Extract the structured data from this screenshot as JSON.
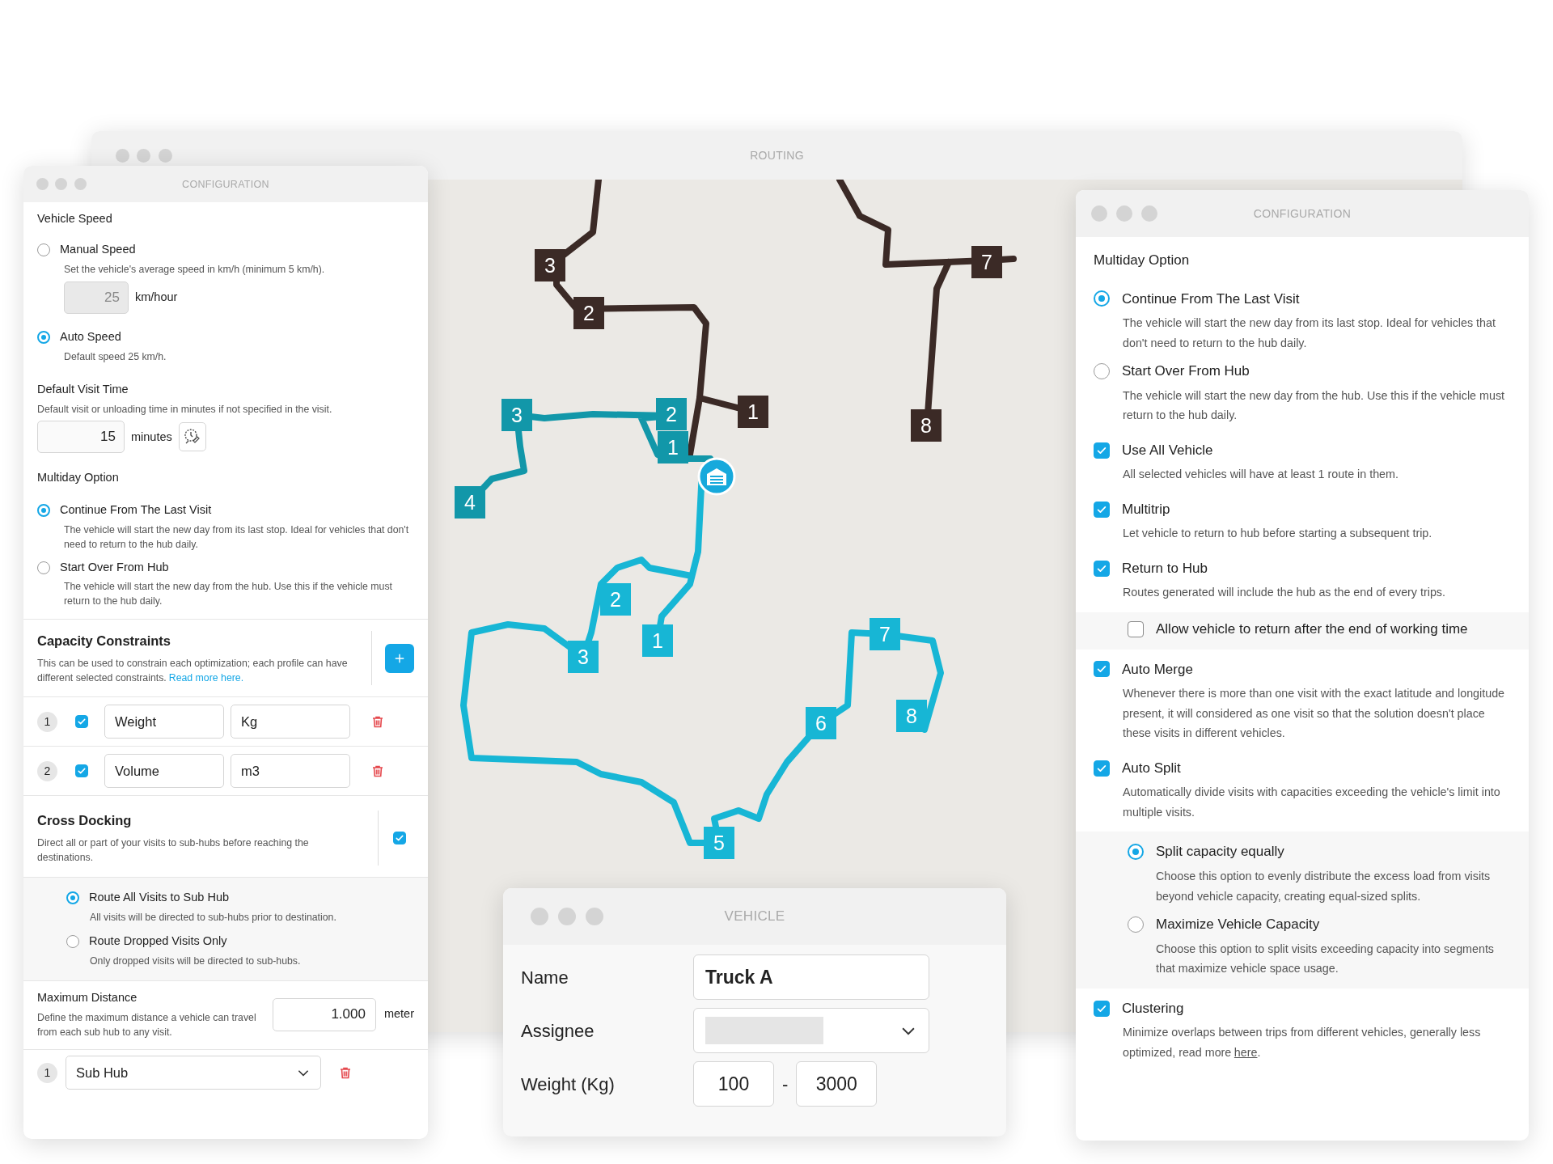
{
  "routing_window": {
    "title": "ROUTING",
    "map": {
      "routes": [
        {
          "color": "#3b2a26",
          "stops": [
            "3",
            "2",
            "1"
          ]
        },
        {
          "color": "#3b2a26",
          "stops": [
            "7",
            "8"
          ]
        },
        {
          "color": "#1297a9",
          "stops": [
            "3",
            "2",
            "1",
            "4"
          ]
        },
        {
          "color": "#17b6d5",
          "stops": [
            "2",
            "3",
            "1",
            "5",
            "6",
            "7",
            "8"
          ]
        }
      ]
    }
  },
  "left_config": {
    "title": "CONFIGURATION",
    "vehicle_speed": {
      "heading": "Vehicle Speed",
      "options": [
        {
          "label": "Manual Speed",
          "description": "Set the vehicle's average speed in km/h (minimum 5 km/h).",
          "selected": false,
          "value": "25",
          "unit": "km/hour"
        },
        {
          "label": "Auto Speed",
          "description": "Default speed 25 km/h.",
          "selected": true
        }
      ]
    },
    "default_visit_time": {
      "heading": "Default Visit Time",
      "description": "Default visit or unloading time in minutes if not specified in the visit.",
      "value": "15",
      "unit": "minutes"
    },
    "multiday_option": {
      "heading": "Multiday Option",
      "options": [
        {
          "label": "Continue From The Last Visit",
          "description": "The vehicle will start the new day from its last stop. Ideal for vehicles that don't need to return to the hub daily.",
          "selected": true
        },
        {
          "label": "Start Over From Hub",
          "description": "The vehicle will start the new day from the hub. Use this if the vehicle must return to the hub daily.",
          "selected": false
        }
      ]
    },
    "capacity_constraints": {
      "heading": "Capacity Constraints",
      "description": "This can be used to constrain each optimization; each profile can have different selected constraints.",
      "link": "Read more here.",
      "rows": [
        {
          "number": "1",
          "checked": true,
          "name": "Weight",
          "unit": "Kg"
        },
        {
          "number": "2",
          "checked": true,
          "name": "Volume",
          "unit": "m3"
        }
      ]
    },
    "cross_docking": {
      "heading": "Cross Docking",
      "description": "Direct all or part of your visits to sub-hubs before reaching the destinations.",
      "checked": true,
      "options": [
        {
          "label": "Route All Visits to Sub Hub",
          "description": "All visits will be directed to sub-hubs prior to destination.",
          "selected": true
        },
        {
          "label": "Route Dropped Visits Only",
          "description": "Only dropped visits will be directed to sub-hubs.",
          "selected": false
        }
      ]
    },
    "maximum_distance": {
      "heading": "Maximum Distance",
      "description": "Define the maximum distance a vehicle can travel from each sub hub to any visit.",
      "value": "1.000",
      "unit": "meter",
      "sub_hubs": [
        {
          "number": "1",
          "value": "Sub Hub"
        }
      ]
    }
  },
  "right_config": {
    "title": "CONFIGURATION",
    "multiday_option": {
      "heading": "Multiday Option",
      "options": [
        {
          "label": "Continue From The Last Visit",
          "description": "The vehicle will start the new day from its last stop. Ideal for vehicles that don't need to return to the hub daily.",
          "selected": true
        },
        {
          "label": "Start Over From Hub",
          "description": "The vehicle will start the new day from the hub. Use this if the vehicle must return to the hub daily.",
          "selected": false
        }
      ]
    },
    "settings": [
      {
        "label": "Use All Vehicle",
        "description": "All selected vehicles will have at least 1 route in them.",
        "checked": true
      },
      {
        "label": "Multitrip",
        "description": "Let vehicle to return to hub before starting a subsequent trip.",
        "checked": true
      },
      {
        "label": "Return to Hub",
        "description": "Routes generated will include the hub as the end of every trips.",
        "checked": true,
        "children": [
          {
            "kind": "checkbox",
            "label": "Allow vehicle to return after the end of working time",
            "checked": false
          }
        ]
      },
      {
        "label": "Auto Merge",
        "description": "Whenever there is more than one visit with the exact latitude and longitude present, it will considered as one visit so that the solution doesn't place these visits in different vehicles.",
        "checked": true
      },
      {
        "label": "Auto Split",
        "description": "Automatically divide visits with capacities exceeding the vehicle's limit into multiple visits.",
        "checked": true,
        "children": [
          {
            "kind": "radio",
            "label": "Split capacity equally",
            "description": "Choose this option to evenly distribute the excess load from visits beyond vehicle capacity, creating equal-sized splits.",
            "selected": true
          },
          {
            "kind": "radio",
            "label": "Maximize Vehicle Capacity",
            "description": "Choose this option to split visits exceeding capacity into segments that maximize vehicle space usage.",
            "selected": false
          }
        ]
      },
      {
        "label": "Clustering",
        "description": "Minimize overlaps between trips from different vehicles, generally less optimized, read more",
        "link": "here",
        "link_suffix": ".",
        "checked": true
      }
    ]
  },
  "vehicle_window": {
    "title": "VEHICLE",
    "fields": [
      {
        "kind": "text",
        "label": "Name",
        "value": "Truck A"
      },
      {
        "kind": "select",
        "label": "Assignee"
      },
      {
        "kind": "range",
        "label": "Weight (Kg)",
        "min": "100",
        "separator": "-",
        "max": "3000"
      }
    ]
  }
}
